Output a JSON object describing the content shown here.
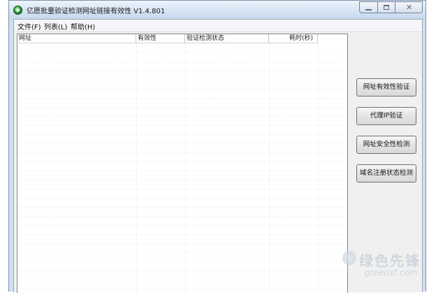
{
  "window": {
    "title": "亿愿批量验证检测网址链接有效性 V1.4.801",
    "icon": "app-green-circle-icon"
  },
  "menu": [
    {
      "label": "文件(F)"
    },
    {
      "label": "列表(L)"
    },
    {
      "label": "帮助(H)"
    }
  ],
  "list": {
    "columns": [
      "网址",
      "有效性",
      "验证检测状态",
      "耗时(秒)"
    ],
    "rows": []
  },
  "actions": [
    {
      "label": "网址有效性验证"
    },
    {
      "label": "代理IP验证"
    },
    {
      "label": "网址安全性检测"
    },
    {
      "label": "域名注册状态检测"
    }
  ],
  "watermark": {
    "text": "绿色先锋",
    "url": "greenxf.com"
  }
}
